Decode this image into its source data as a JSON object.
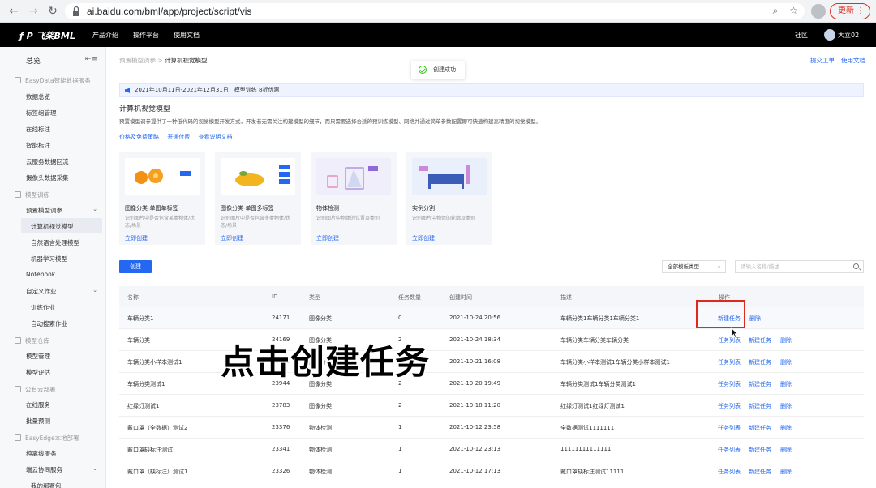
{
  "browser": {
    "url": "ai.baidu.com/bml/app/project/script/vis",
    "update_label": "更新",
    "menu_dots": "⋮"
  },
  "header": {
    "logo": "飞桨BML",
    "logo_mark": "ƒ P",
    "nav": [
      "产品介绍",
      "操作平台",
      "使用文档"
    ],
    "community": "社区",
    "user": "大立02"
  },
  "sidebar": {
    "title": "总览",
    "sections": [
      {
        "label": "EasyData智能数据服务",
        "items": [
          "数据总览",
          "标签组管理",
          "在线标注",
          "智能标注",
          "云服务数据回流",
          "摄像头数据采集"
        ]
      },
      {
        "label": "模型训练",
        "items": [
          "预置模型调参",
          "计算机视觉模型",
          "自然语言处理模型",
          "机器学习模型",
          "Notebook",
          "自定义作业",
          "训练作业",
          "自动搜索作业"
        ]
      },
      {
        "label": "模型仓库",
        "items": [
          "模型管理",
          "模型评估"
        ]
      },
      {
        "label": "公有云部署",
        "items": [
          "在线服务",
          "批量预测"
        ]
      },
      {
        "label": "EasyEdge本地部署",
        "items": [
          "纯离线服务",
          "端云协同服务",
          "我的部署包"
        ]
      }
    ]
  },
  "main": {
    "breadcrumb_parent": "预置模型调参",
    "breadcrumb_sep": " > ",
    "breadcrumb_current": "计算机视觉模型",
    "submit_ticket": "提交工单",
    "docs": "使用文档",
    "toast": "创建成功",
    "notice": "2021年10月11日-2021年12月31日，模型训练 8折优惠",
    "title": "计算机视觉模型",
    "description": "预置模型调参提供了一种低代码的视觉模型开发方式，开发者无需关注构建模型的细节，而只需要选择合适的预训练模型、网络并通过简单参数配置即可快速构建高精度的视觉模型。",
    "links": [
      "价格及免费策略",
      "开通付费",
      "查看说明文档"
    ],
    "cards": [
      {
        "name": "图像分类-单图单标签",
        "desc": "识别图片中是否包含某类物体/状态/场景",
        "link": "立即创建",
        "tag": "水果"
      },
      {
        "name": "图像分类-单图多标签",
        "desc": "识别图片中是否包含多类物体/状态/场景",
        "link": "立即创建",
        "tag": "水果"
      },
      {
        "name": "物体检测",
        "desc": "识别图片中物体的位置及类别",
        "link": "立即创建",
        "tag": ""
      },
      {
        "name": "实例分割",
        "desc": "识别图片中物体的轮廓及类别",
        "link": "立即创建",
        "tag": ""
      }
    ],
    "create_button": "创建",
    "filter_select": "全部模板类型",
    "search_placeholder": "请输入名称/描述",
    "table": {
      "columns": [
        "名称",
        "ID",
        "类型",
        "任务数量",
        "创建时间",
        "描述",
        "操作"
      ],
      "rows": [
        {
          "name": "车辆分类1",
          "id": "24171",
          "type": "图像分类",
          "count": "0",
          "time": "2021-10-24 20:56",
          "desc": "车辆分类1车辆分类1车辆分类1",
          "actions": [
            "新建任务",
            "删除"
          ]
        },
        {
          "name": "车辆分类",
          "id": "24169",
          "type": "图像分类",
          "count": "2",
          "time": "2021-10-24 18:34",
          "desc": "车辆分类车辆分类车辆分类",
          "actions": [
            "任务列表",
            "新建任务",
            "删除"
          ]
        },
        {
          "name": "车辆分类小样本测试1",
          "id": "24020",
          "type": "图像分类",
          "count": "2",
          "time": "2021-10-21 16:08",
          "desc": "车辆分类小样本测试1车辆分类小样本测试1",
          "actions": [
            "任务列表",
            "新建任务",
            "删除"
          ]
        },
        {
          "name": "车辆分类测试1",
          "id": "23944",
          "type": "图像分类",
          "count": "2",
          "time": "2021-10-20 19:49",
          "desc": "车辆分类测试1车辆分类测试1",
          "actions": [
            "任务列表",
            "新建任务",
            "删除"
          ]
        },
        {
          "name": "红绿灯测试1",
          "id": "23783",
          "type": "图像分类",
          "count": "2",
          "time": "2021-10-18 11:20",
          "desc": "红绿灯测试1红绿灯测试1",
          "actions": [
            "任务列表",
            "新建任务",
            "删除"
          ]
        },
        {
          "name": "戴口罩（全数据）测试2",
          "id": "23376",
          "type": "物体检测",
          "count": "1",
          "time": "2021-10-12 23:58",
          "desc": "全数据测试1111111",
          "actions": [
            "任务列表",
            "新建任务",
            "删除"
          ]
        },
        {
          "name": "戴口罩缺标注测试",
          "id": "23341",
          "type": "物体检测",
          "count": "1",
          "time": "2021-10-12 23:13",
          "desc": "11111111111111",
          "actions": [
            "任务列表",
            "新建任务",
            "删除"
          ]
        },
        {
          "name": "戴口罩（缺标注）测试1",
          "id": "23326",
          "type": "物体检测",
          "count": "1",
          "time": "2021-10-12 17:13",
          "desc": "戴口罩缺标注测试11111",
          "actions": [
            "任务列表",
            "新建任务",
            "删除"
          ]
        }
      ]
    }
  },
  "caption": "点击创建任务",
  "colors": {
    "accent": "#2468f2",
    "highlight": "#e0281e",
    "success": "#30bf13"
  }
}
